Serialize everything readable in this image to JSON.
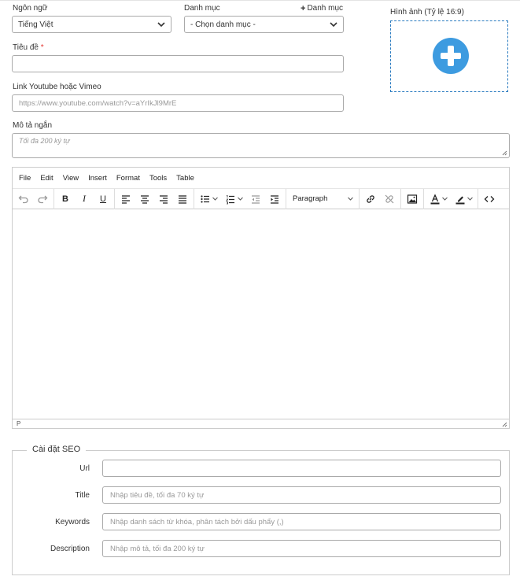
{
  "form": {
    "language_label": "Ngôn ngữ",
    "language_value": "Tiếng Việt",
    "category_label": "Danh mục",
    "add_category_label": "Danh mục",
    "category_value": "- Chọn danh mục -",
    "title_label": "Tiêu đề",
    "required_mark": "*",
    "video_label": "Link Youtube hoặc Vimeo",
    "video_placeholder": "https://www.youtube.com/watch?v=aYrIkJl9MrE",
    "summary_label": "Mô tả ngắn",
    "summary_placeholder": "Tối đa 200 ký tự",
    "image_label": "Hình ảnh (Tỷ lệ 16:9)"
  },
  "editor": {
    "menu": [
      "File",
      "Edit",
      "View",
      "Insert",
      "Format",
      "Tools",
      "Table"
    ],
    "block_format": "Paragraph",
    "status_path": "P"
  },
  "seo": {
    "legend": "Cài đặt SEO",
    "url_label": "Url",
    "title_label": "Title",
    "title_placeholder": "Nhập tiêu đề, tối đa 70 ký tự",
    "keywords_label": "Keywords",
    "keywords_placeholder": "Nhập danh sách từ khóa, phân tách bởi dấu phẩy (,)",
    "description_label": "Description",
    "description_placeholder": "Nhập mô tả, tối đa 200 ký tự"
  },
  "colors": {
    "accent": "#3d9be0",
    "dashed_border": "#2a7bc0",
    "required": "#e53935"
  },
  "icons": [
    "chevron-down-icon",
    "plus-icon",
    "undo-icon",
    "redo-icon",
    "bold-icon",
    "italic-icon",
    "underline-icon",
    "align-left-icon",
    "align-center-icon",
    "align-right-icon",
    "align-justify-icon",
    "bullet-list-icon",
    "numbered-list-icon",
    "outdent-icon",
    "indent-icon",
    "link-icon",
    "unlink-icon",
    "image-icon",
    "text-color-icon",
    "highlight-icon",
    "source-code-icon",
    "resize-grip-icon"
  ]
}
